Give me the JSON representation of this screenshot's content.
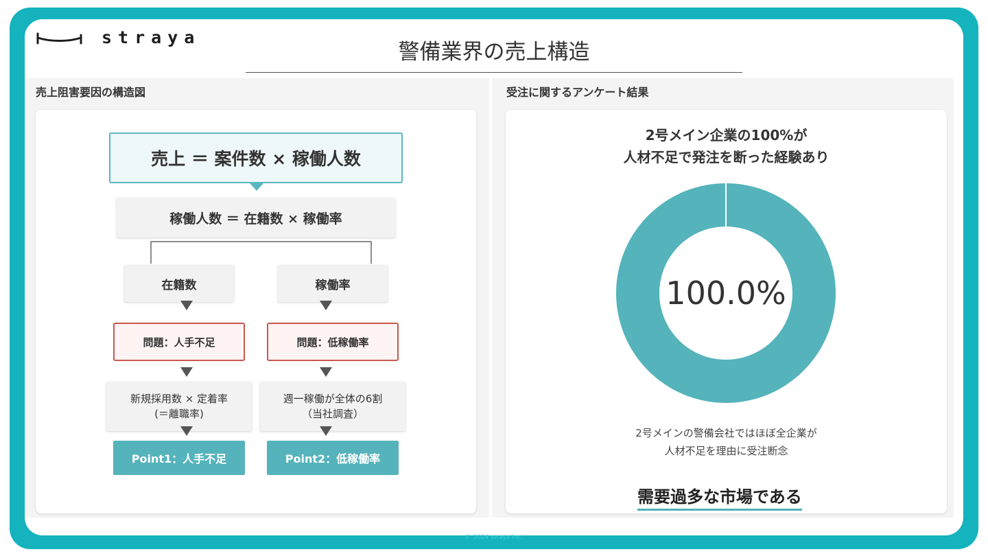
{
  "brand": {
    "name": "straya",
    "logo_icon": "hanger-line-icon"
  },
  "page_title": "警備業界の売上構造",
  "left": {
    "title": "売上阻害要因の構造図",
    "formula_main": "売上 ＝ 案件数 × 稼働人数",
    "formula_sub": "稼働人数 ＝ 在籍数 × 稼働率",
    "branches": [
      {
        "label": "在籍数",
        "problem": "問題：人手不足",
        "note_line1": "新規採用数 × 定着率",
        "note_line2": "(＝離職率)",
        "point": "Point1：人手不足"
      },
      {
        "label": "稼働率",
        "problem": "問題：低稼働率",
        "note_line1": "週一稼働が全体の6割",
        "note_line2": "（当社調査）",
        "point": "Point2：低稼働率"
      }
    ]
  },
  "right": {
    "title": "受注に関するアンケート結果",
    "chart_title_line1": "2号メイン企業の100%が",
    "chart_title_line2": "人材不足で発注を断った経験あり",
    "caption_line1": "2号メインの警備会社ではほぼ全企業が",
    "caption_line2": "人材不足を理由に受注断念",
    "conclusion": "需要過多な市場である"
  },
  "chart_data": {
    "type": "pie",
    "categories": [
      "人材不足で発注を断った経験あり"
    ],
    "values": [
      100.0
    ],
    "center_label": "100.0%",
    "colors": [
      "#55b3bb"
    ]
  },
  "footer": "© 2024 straya Inc."
}
